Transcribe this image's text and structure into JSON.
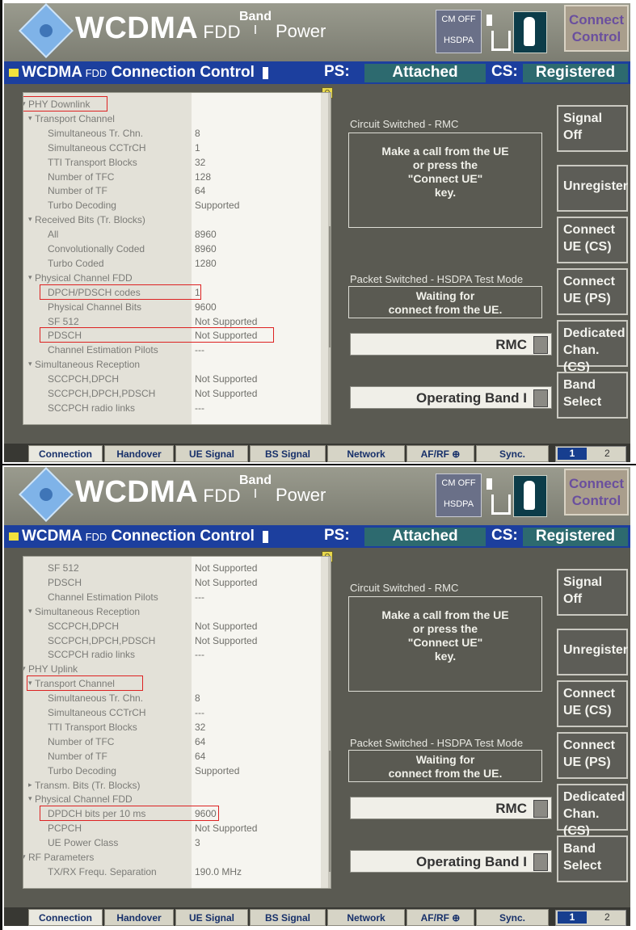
{
  "header": {
    "app": "WCDMA",
    "fdd": "FDD",
    "band_label": "Band",
    "band_value": "I",
    "power": "Power",
    "cm_off": "CM OFF",
    "hsdpa": "HSDPA",
    "connect_control_l1": "Connect",
    "connect_control_l2": "Control"
  },
  "subheader": {
    "title": "WCDMA",
    "fdd": "FDD",
    "connection_control": "Connection Control",
    "ps_label": "PS:",
    "ps_value": "Attached",
    "cs_label": "CS:",
    "cs_value": "Registered"
  },
  "panel": {
    "cs_label": "Circuit Switched - RMC",
    "cs_msg_l1": "Make a call from the UE",
    "cs_msg_l2": "or press the",
    "cs_msg_l3": "\"Connect UE\"",
    "cs_msg_l4": "key.",
    "ps_label": "Packet Switched - HSDPA Test Mode",
    "ps_msg_l1": "Waiting for",
    "ps_msg_l2": "connect from the UE.",
    "rmc": "RMC",
    "operating_band": "Operating Band I"
  },
  "buttons": [
    {
      "l1": "Signal",
      "l2": "Off"
    },
    {
      "l1": "Unregister",
      "l2": ""
    },
    {
      "l1": "Connect",
      "l2": "UE (CS)"
    },
    {
      "l1": "Connect",
      "l2": "UE (PS)"
    },
    {
      "l1": "Dedicated",
      "l2": "Chan. (CS)"
    },
    {
      "l1": "Band",
      "l2": "Select"
    }
  ],
  "tabs": [
    "Connection",
    "Handover",
    "UE Signal",
    "BS Signal",
    "Network",
    "AF/RF",
    "Sync."
  ],
  "pages": [
    "1",
    "2"
  ],
  "tree1": [
    {
      "name": "PHY Downlink",
      "value": "",
      "indent": 1,
      "arrow": "down"
    },
    {
      "name": "Transport Channel",
      "value": "",
      "indent": 2,
      "arrow": "down"
    },
    {
      "name": "Simultaneous Tr. Chn.",
      "value": "8",
      "indent": 3,
      "arrow": ""
    },
    {
      "name": "Simultaneous CCTrCH",
      "value": "1",
      "indent": 3,
      "arrow": ""
    },
    {
      "name": "TTI Transport Blocks",
      "value": "32",
      "indent": 3,
      "arrow": ""
    },
    {
      "name": "Number of TFC",
      "value": "128",
      "indent": 3,
      "arrow": ""
    },
    {
      "name": "Number of TF",
      "value": "64",
      "indent": 3,
      "arrow": ""
    },
    {
      "name": "Turbo Decoding",
      "value": "Supported",
      "indent": 3,
      "arrow": ""
    },
    {
      "name": "Received Bits (Tr. Blocks)",
      "value": "",
      "indent": 2,
      "arrow": "down"
    },
    {
      "name": "All",
      "value": "8960",
      "indent": 3,
      "arrow": ""
    },
    {
      "name": "Convolutionally Coded",
      "value": "8960",
      "indent": 3,
      "arrow": ""
    },
    {
      "name": "Turbo Coded",
      "value": "1280",
      "indent": 3,
      "arrow": ""
    },
    {
      "name": "Physical Channel FDD",
      "value": "",
      "indent": 2,
      "arrow": "down"
    },
    {
      "name": "DPCH/PDSCH codes",
      "value": "1",
      "indent": 3,
      "arrow": ""
    },
    {
      "name": "Physical Channel Bits",
      "value": "9600",
      "indent": 3,
      "arrow": ""
    },
    {
      "name": "SF 512",
      "value": "Not Supported",
      "indent": 3,
      "arrow": ""
    },
    {
      "name": "PDSCH",
      "value": "Not Supported",
      "indent": 3,
      "arrow": ""
    },
    {
      "name": "Channel Estimation Pilots",
      "value": "---",
      "indent": 3,
      "arrow": ""
    },
    {
      "name": "Simultaneous Reception",
      "value": "",
      "indent": 2,
      "arrow": "down"
    },
    {
      "name": "SCCPCH,DPCH",
      "value": "Not Supported",
      "indent": 3,
      "arrow": ""
    },
    {
      "name": "SCCPCH,DPCH,PDSCH",
      "value": "Not Supported",
      "indent": 3,
      "arrow": ""
    },
    {
      "name": "SCCPCH radio links",
      "value": "---",
      "indent": 3,
      "arrow": ""
    }
  ],
  "tree2": [
    {
      "name": "SF 512",
      "value": "Not Supported",
      "indent": 3,
      "arrow": ""
    },
    {
      "name": "PDSCH",
      "value": "Not Supported",
      "indent": 3,
      "arrow": ""
    },
    {
      "name": "Channel Estimation Pilots",
      "value": "---",
      "indent": 3,
      "arrow": ""
    },
    {
      "name": "Simultaneous Reception",
      "value": "",
      "indent": 2,
      "arrow": "down"
    },
    {
      "name": "SCCPCH,DPCH",
      "value": "Not Supported",
      "indent": 3,
      "arrow": ""
    },
    {
      "name": "SCCPCH,DPCH,PDSCH",
      "value": "Not Supported",
      "indent": 3,
      "arrow": ""
    },
    {
      "name": "SCCPCH radio links",
      "value": "---",
      "indent": 3,
      "arrow": ""
    },
    {
      "name": "PHY Uplink",
      "value": "",
      "indent": 1,
      "arrow": "down"
    },
    {
      "name": "Transport Channel",
      "value": "",
      "indent": 2,
      "arrow": "down"
    },
    {
      "name": "Simultaneous Tr. Chn.",
      "value": "8",
      "indent": 3,
      "arrow": ""
    },
    {
      "name": "Simultaneous CCTrCH",
      "value": "---",
      "indent": 3,
      "arrow": ""
    },
    {
      "name": "TTI Transport Blocks",
      "value": "32",
      "indent": 3,
      "arrow": ""
    },
    {
      "name": "Number of TFC",
      "value": "64",
      "indent": 3,
      "arrow": ""
    },
    {
      "name": "Number of TF",
      "value": "64",
      "indent": 3,
      "arrow": ""
    },
    {
      "name": "Turbo Decoding",
      "value": "Supported",
      "indent": 3,
      "arrow": ""
    },
    {
      "name": "Transm. Bits (Tr. Blocks)",
      "value": "",
      "indent": 2,
      "arrow": "right"
    },
    {
      "name": "Physical Channel FDD",
      "value": "",
      "indent": 2,
      "arrow": "down"
    },
    {
      "name": "DPDCH bits per 10 ms",
      "value": "9600",
      "indent": 3,
      "arrow": ""
    },
    {
      "name": "PCPCH",
      "value": "Not Supported",
      "indent": 3,
      "arrow": ""
    },
    {
      "name": "UE Power Class",
      "value": "3",
      "indent": 3,
      "arrow": ""
    },
    {
      "name": "RF Parameters",
      "value": "",
      "indent": 1,
      "arrow": "down"
    },
    {
      "name": "TX/RX Frequ. Separation",
      "value": "190.0 MHz",
      "indent": 3,
      "arrow": ""
    }
  ],
  "highlights1": [
    "PHY Downlink",
    "DPCH/PDSCH codes",
    "PDSCH"
  ],
  "highlights2": [
    "Transport Channel",
    "DPDCH bits per 10 ms"
  ]
}
